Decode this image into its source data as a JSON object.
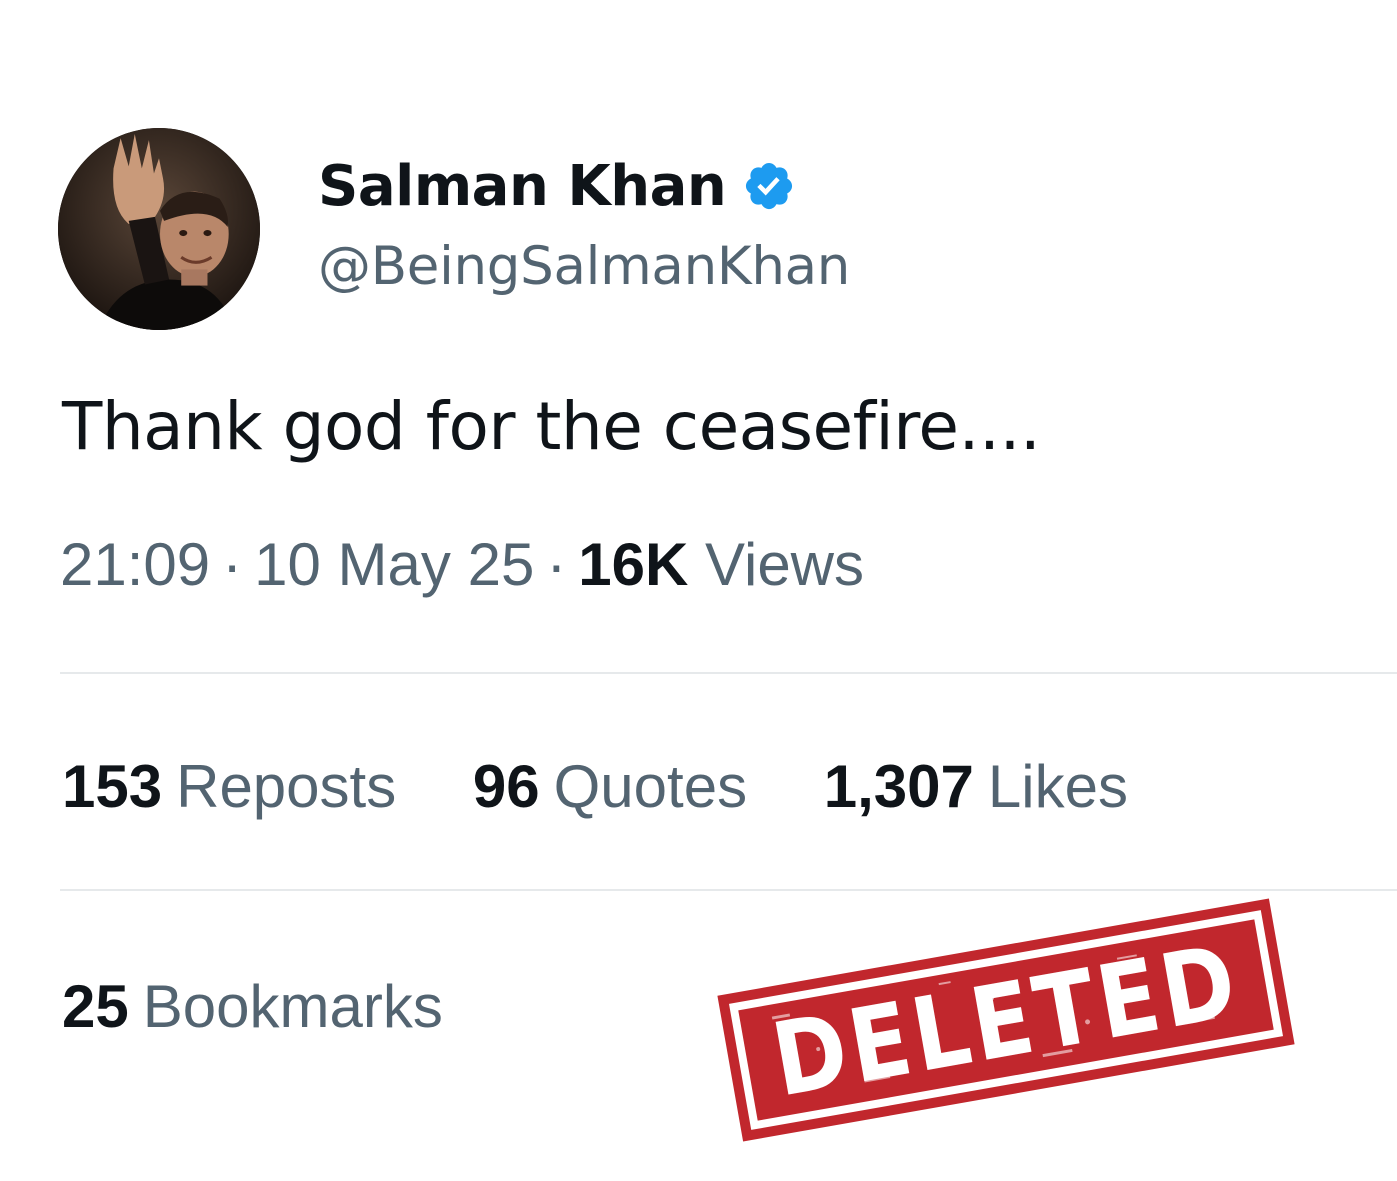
{
  "author": {
    "display_name": "Salman Khan",
    "handle": "@BeingSalmanKhan",
    "verified_icon": "verified-badge-icon",
    "avatar_icon": "profile-photo"
  },
  "tweet": {
    "text": "Thank god for the ceasefire....",
    "time": "21:09",
    "date": "10 May 25",
    "separator": "·",
    "views_count": "16K",
    "views_label": "Views"
  },
  "stats": {
    "reposts_count": "153",
    "reposts_label": "Reposts",
    "quotes_count": "96",
    "quotes_label": "Quotes",
    "likes_count": "1,307",
    "likes_label": "Likes",
    "bookmarks_count": "25",
    "bookmarks_label": "Bookmarks"
  },
  "stamp": {
    "text": "DELETED"
  },
  "colors": {
    "text_primary": "#0f1419",
    "text_secondary": "#536471",
    "verified_blue": "#1d9bf0",
    "divider": "#e6e9eb",
    "stamp_red": "#c1272d"
  }
}
